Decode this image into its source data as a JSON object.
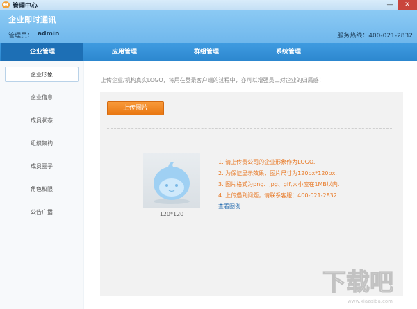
{
  "window": {
    "title": "管理中心",
    "minimize": "—",
    "close": "✕"
  },
  "header": {
    "title": "企业即时通讯",
    "admin_label": "管理员：",
    "admin_name": "admin",
    "hotline": "服务热线：400-021-2832"
  },
  "nav": {
    "items": [
      {
        "label": "企业管理"
      },
      {
        "label": "应用管理"
      },
      {
        "label": "群组管理"
      },
      {
        "label": "系统管理"
      }
    ]
  },
  "sidebar": {
    "items": [
      {
        "label": "企业形象"
      },
      {
        "label": "企业信息"
      },
      {
        "label": "成员状态"
      },
      {
        "label": "组织架构"
      },
      {
        "label": "成员圈子"
      },
      {
        "label": "角色权限"
      },
      {
        "label": "公告广播"
      }
    ]
  },
  "main": {
    "hint": "上传企业/机构真实LOGO，将用在登录客户端的过程中，亦可以增强员工对企业的归属感！",
    "upload_label": "上传图片",
    "avatar_caption": "120*120",
    "tips": [
      "1. 请上传贵公司的企业形象作为LOGO.",
      "2. 为保证显示效果，图片尺寸为120px*120px.",
      "3. 图片格式为png、jpg、gif,大小应在1MB以内.",
      "4. 上传遇到问题，请联系客服：400-021-2832."
    ],
    "example_link": "查看图例"
  },
  "watermark": {
    "text": "下载吧",
    "url": "www.xiazaiba.com"
  },
  "colors": {
    "accent": "#2c87cf",
    "nav_active": "#1d6fb5",
    "button": "#e97712",
    "tip_text": "#e87722",
    "link": "#2a6fb0"
  }
}
